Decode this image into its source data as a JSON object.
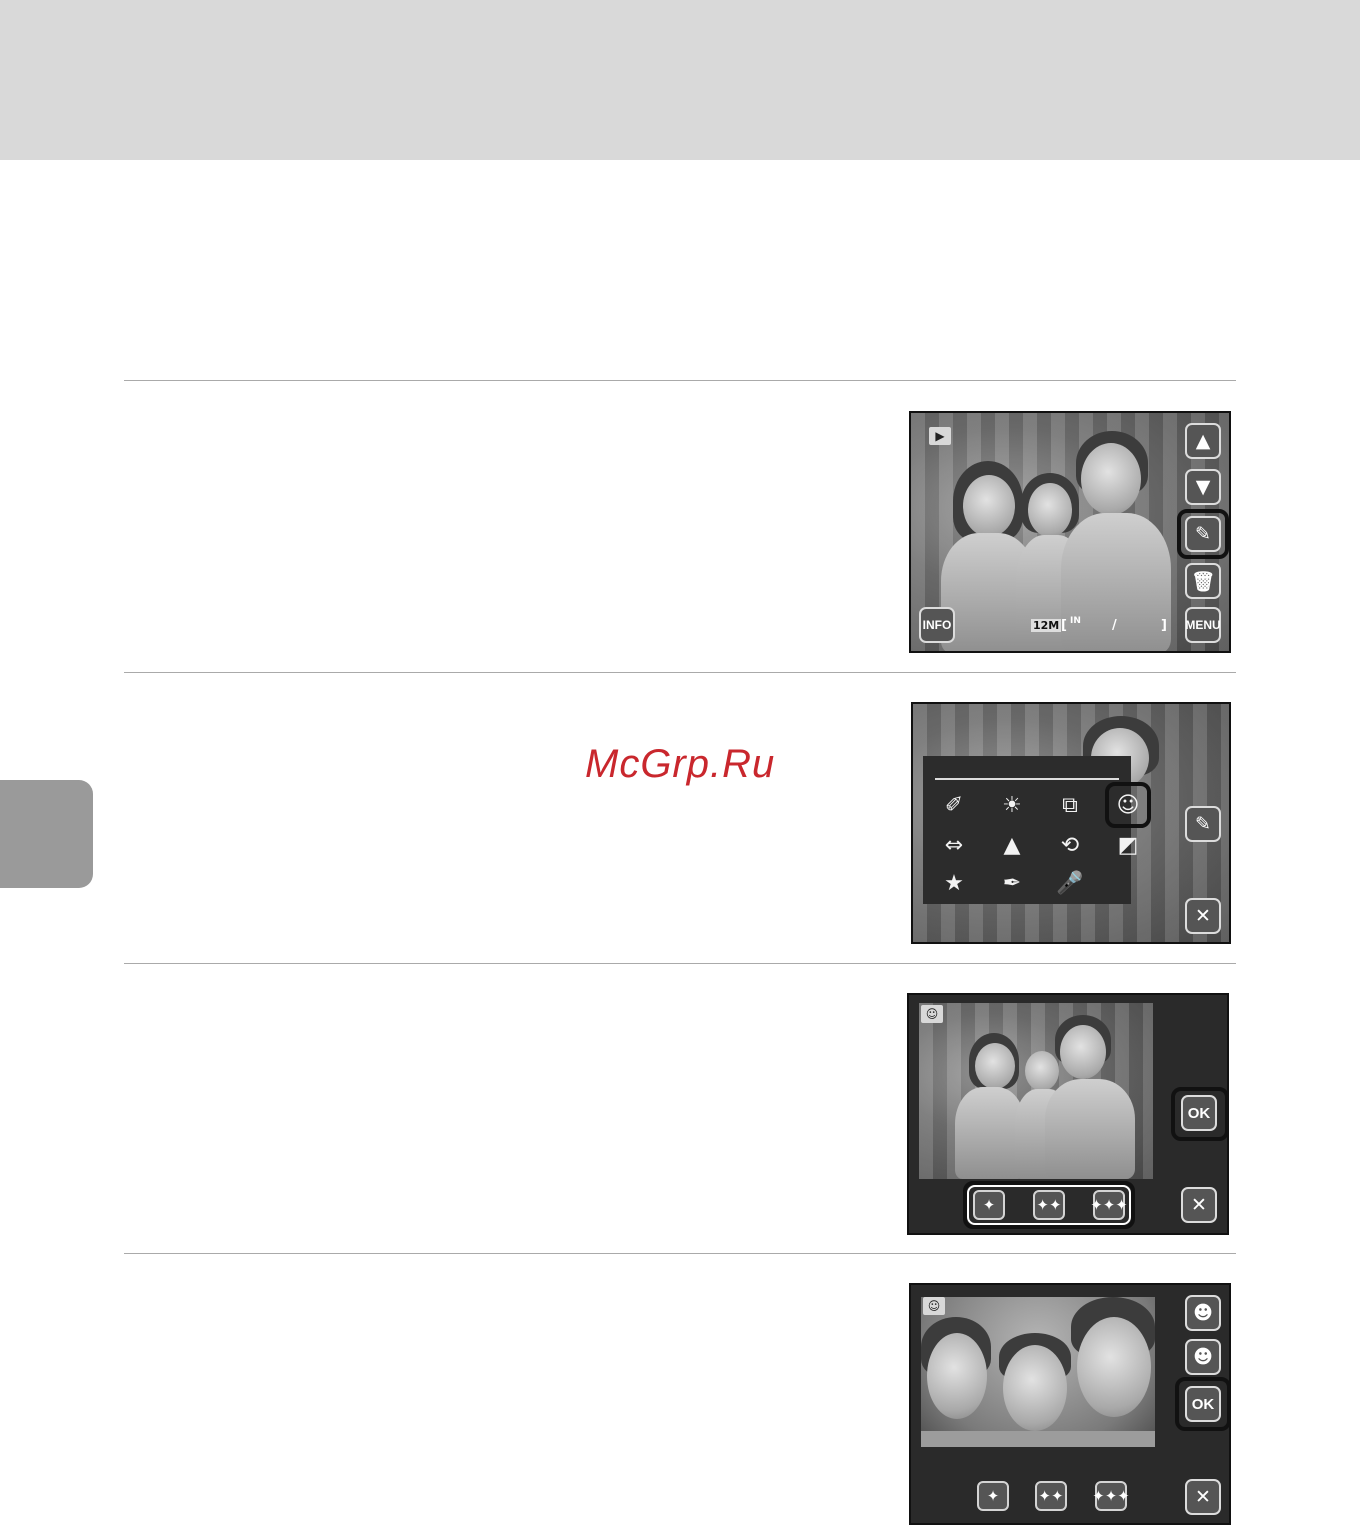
{
  "page": {
    "watermark": "McGrp.Ru",
    "accent_color": "#c9272d",
    "band_color": "#d9d9d9"
  },
  "screen1": {
    "play_icon": "▶",
    "up_icon": "▲",
    "down_icon": "▼",
    "retouch_icon": "✎",
    "delete_icon": "🗑",
    "info_label": "INFO",
    "menu_label": "MENU",
    "size_badge": "12M",
    "bracket_open": "[",
    "memory_label": "IN",
    "slash": "/",
    "bracket_close": "]"
  },
  "screen2": {
    "menu_icons": [
      "✐",
      "☀",
      "⧉",
      "☺",
      "⇔",
      "▲",
      "⟲",
      "◩",
      "★",
      "✒",
      "🎤"
    ],
    "retouch_icon": "✎",
    "close_icon": "✕"
  },
  "screen3": {
    "mode_icon": "☺",
    "ok_label": "OK",
    "close_icon": "✕",
    "levels": [
      "✦",
      "✦✦",
      "✦✦✦"
    ]
  },
  "screen4": {
    "mode_icon": "☺",
    "face_prev_icon": "☻",
    "face_next_icon": "☻",
    "ok_label": "OK",
    "close_icon": "✕",
    "levels": [
      "✦",
      "✦✦",
      "✦✦✦"
    ]
  }
}
